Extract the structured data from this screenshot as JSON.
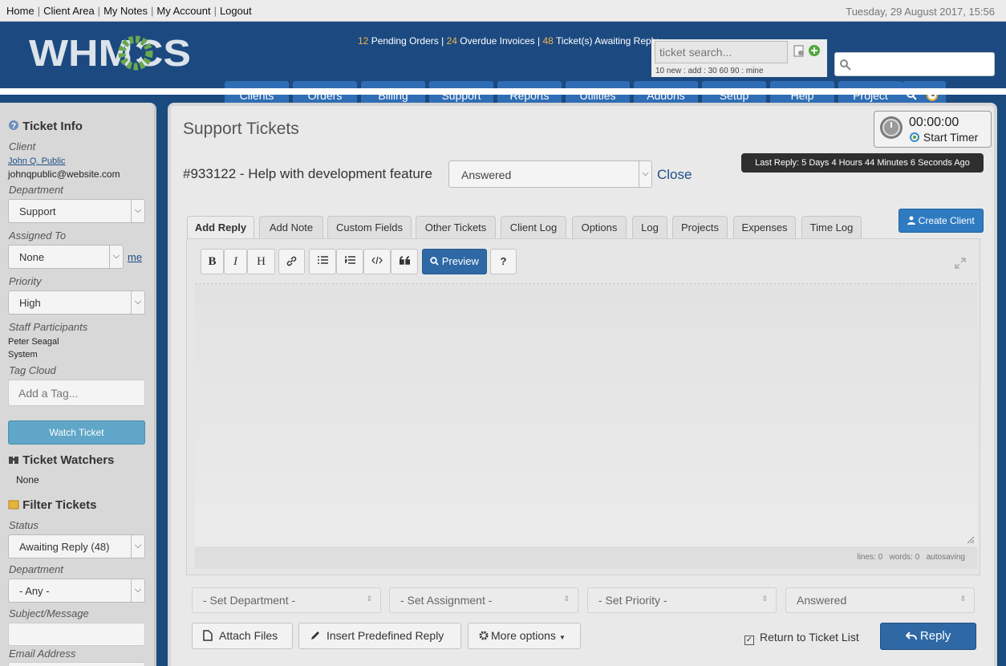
{
  "topbar": {
    "links": [
      "Home",
      "Client Area",
      "My Notes",
      "My Account",
      "Logout"
    ],
    "separator": "|",
    "datetime": "Tuesday, 29 August 2017, 15:56"
  },
  "header": {
    "logo_text": "WHMCS",
    "stats": {
      "pending_orders_count": "12",
      "pending_orders_label": "Pending Orders",
      "overdue_count": "24",
      "overdue_label": "Overdue Invoices",
      "tickets_count": "48",
      "tickets_label": "Ticket(s) Awaiting Reply",
      "separator": "|"
    },
    "ticket_search": {
      "placeholder": "ticket search...",
      "help": "10 new : add : 30 60 90 : mine"
    },
    "global_search": {
      "value": ""
    },
    "nav": [
      "Clients",
      "Orders",
      "Billing",
      "Support",
      "Reports",
      "Utilities",
      "Addons",
      "Setup",
      "Help",
      "Project"
    ]
  },
  "sidebar": {
    "ticket_info": {
      "title": "Ticket Info",
      "client_label": "Client",
      "client_name": "John Q. Public",
      "client_email": "johnqpublic@website.com",
      "department_label": "Department",
      "department_value": "Support",
      "assigned_label": "Assigned To",
      "assigned_value": "None",
      "me_link": "me",
      "priority_label": "Priority",
      "priority_value": "High",
      "staff_label": "Staff Participants",
      "staff": [
        "Peter Seagal",
        "System"
      ],
      "tag_label": "Tag Cloud",
      "tag_placeholder": "Add a Tag...",
      "watch_button": "Watch Ticket"
    },
    "watchers": {
      "title": "Ticket Watchers",
      "value": "None"
    },
    "filter": {
      "title": "Filter Tickets",
      "status_label": "Status",
      "status_value": "Awaiting Reply (48)",
      "department_label": "Department",
      "department_value": "- Any -",
      "subject_label": "Subject/Message",
      "email_label": "Email Address"
    }
  },
  "main": {
    "page_title": "Support Tickets",
    "timer": {
      "time": "00:00:00",
      "label": "Start Timer"
    },
    "last_reply": "Last Reply: 5 Days 4 Hours 44 Minutes 6 Seconds Ago",
    "ticket_title": "#933122 - Help with development feature",
    "status_value": "Answered",
    "close_link": "Close",
    "create_client": "Create Client",
    "tabs": [
      "Add Reply",
      "Add Note",
      "Custom Fields",
      "Other Tickets",
      "Client Log",
      "Options",
      "Log",
      "Projects",
      "Expenses",
      "Time Log"
    ],
    "editor": {
      "bold": "B",
      "italic": "I",
      "heading": "H",
      "preview": "Preview",
      "help": "?",
      "status": "lines: 0   words: 0   autosaving"
    },
    "bottom": {
      "set_department": "- Set Department -",
      "set_assignment": "- Set Assignment -",
      "set_priority": "- Set Priority -",
      "set_status": "Answered",
      "attach": "Attach Files",
      "predefined": "Insert Predefined Reply",
      "more": "More options",
      "return_label": "Return to Ticket List",
      "reply": "Reply"
    }
  },
  "colors": {
    "brand_blue": "#1c4a80",
    "nav_tab": "#2f6eb4",
    "accent_orange": "#f0b64c",
    "primary_button": "#2e68a5"
  }
}
